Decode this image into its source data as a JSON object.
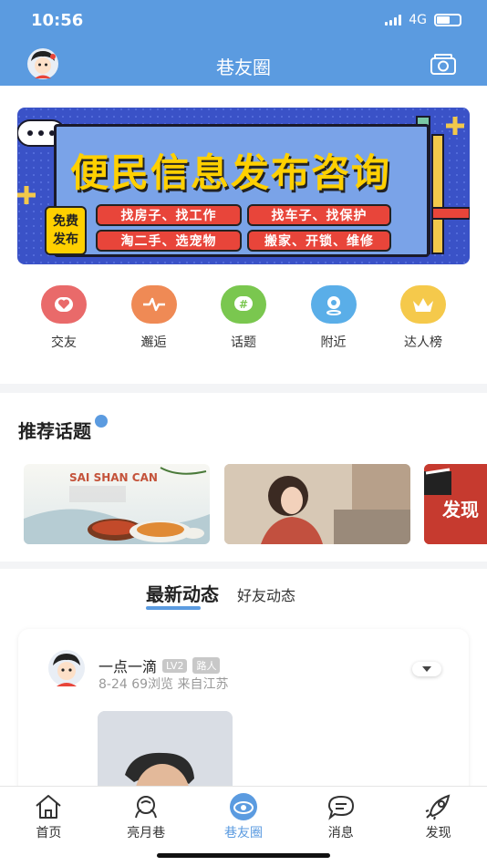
{
  "status_bar": {
    "time": "10:56",
    "network": "4G"
  },
  "header": {
    "title": "巷友圈",
    "avatar_icon": "user-avatar",
    "camera_icon": "camera-icon"
  },
  "banner": {
    "title": "便民信息发布咨询",
    "badge_line1": "免费",
    "badge_line2": "发布",
    "pills": [
      "找房子、找工作",
      "找车子、找保护",
      "淘二手、选宠物",
      "搬家、开锁、维修"
    ],
    "colors": {
      "background": "#3a52c7",
      "title": "#ffd000",
      "pill": "#e8453a"
    }
  },
  "quick_icons": [
    {
      "label": "交友",
      "icon": "heart-icon",
      "color": "#e96a6a"
    },
    {
      "label": "邂逅",
      "icon": "heartbeat-icon",
      "color": "#ef8a55"
    },
    {
      "label": "话题",
      "icon": "hashtag-icon",
      "color": "#7ac74f"
    },
    {
      "label": "附近",
      "icon": "location-icon",
      "color": "#5aaee8"
    },
    {
      "label": "达人榜",
      "icon": "crown-icon",
      "color": "#f5c94b"
    }
  ],
  "topics": {
    "title": "推荐话题",
    "cards": [
      {
        "text": "SAI SHAN CAN"
      },
      {
        "text": ""
      },
      {
        "text": "发现"
      }
    ]
  },
  "feed": {
    "tabs": [
      "最新动态",
      "好友动态"
    ],
    "post": {
      "username": "一点一滴",
      "level": "LV2",
      "role": "路人",
      "date": "8-24",
      "views": "69浏览",
      "location": "来自江苏"
    }
  },
  "tabbar": [
    {
      "label": "首页",
      "icon": "home-icon"
    },
    {
      "label": "亮月巷",
      "icon": "moon-lane-icon"
    },
    {
      "label": "巷友圈",
      "icon": "circle-icon",
      "active": true
    },
    {
      "label": "消息",
      "icon": "message-icon"
    },
    {
      "label": "发现",
      "icon": "rocket-icon"
    }
  ],
  "colors": {
    "primary": "#5b9be0"
  }
}
